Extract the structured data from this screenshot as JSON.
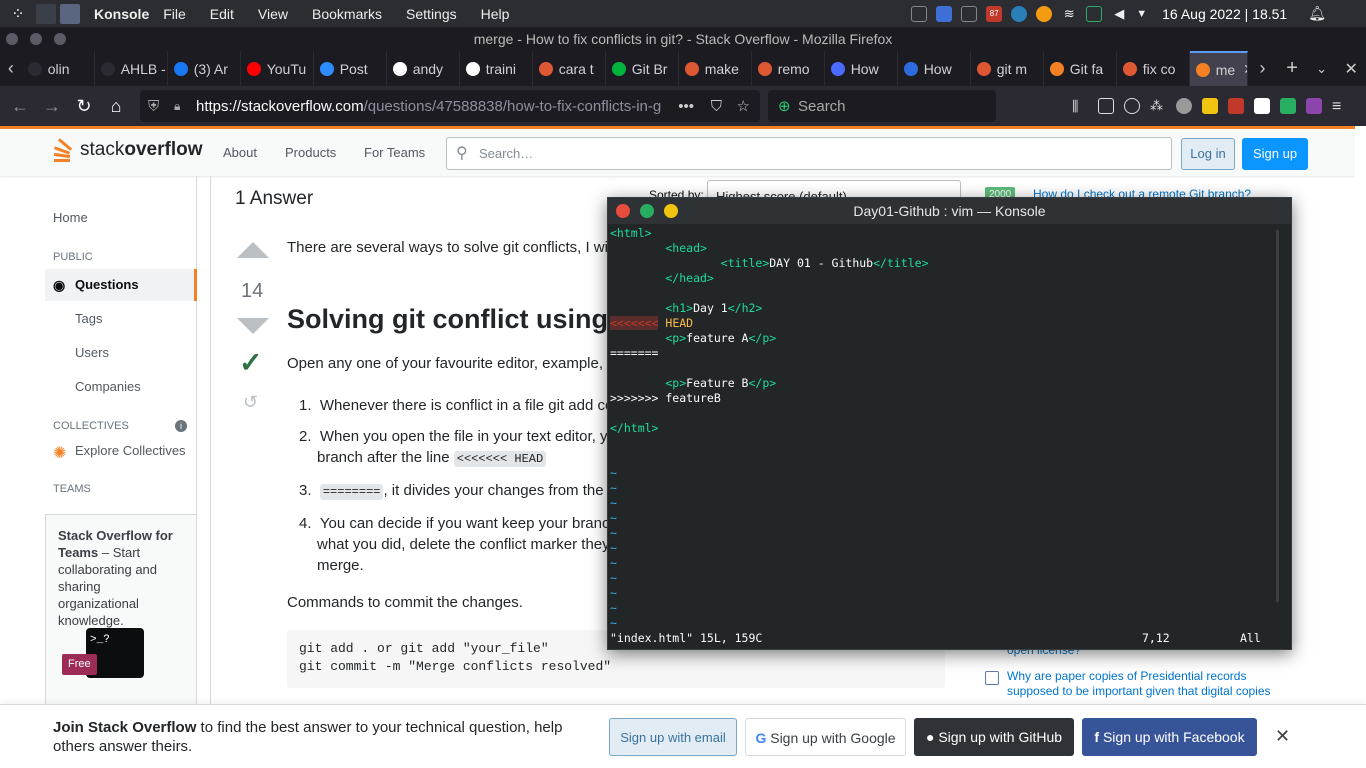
{
  "panel": {
    "app": "Konsole",
    "menu": [
      "File",
      "Edit",
      "View",
      "Bookmarks",
      "Settings",
      "Help"
    ],
    "battery": "87",
    "clock": "16 Aug 2022 | 18.51"
  },
  "firefox": {
    "title": "merge - How to fix conflicts in git? - Stack Overflow - Mozilla Firefox",
    "tabs": [
      {
        "label": "olin",
        "color": "#2b2a33"
      },
      {
        "label": "AHLB - B",
        "color": "#2b2a33"
      },
      {
        "label": "(3) Ar",
        "color": "#1877f2"
      },
      {
        "label": "YouTu",
        "color": "#ff0000"
      },
      {
        "label": "Post",
        "color": "#2d8cff"
      },
      {
        "label": "andy",
        "color": "#ffffff"
      },
      {
        "label": "traini",
        "color": "#ffffff"
      },
      {
        "label": "cara t",
        "color": "#de5833"
      },
      {
        "label": "Git Br",
        "color": "#00b33c"
      },
      {
        "label": "make",
        "color": "#de5833"
      },
      {
        "label": "remo",
        "color": "#de5833"
      },
      {
        "label": "How",
        "color": "#4b6aff"
      },
      {
        "label": "How",
        "color": "#2d6cdf"
      },
      {
        "label": "git m",
        "color": "#de5833"
      },
      {
        "label": "Git fa",
        "color": "#f48225"
      },
      {
        "label": "fix co",
        "color": "#de5833"
      },
      {
        "label": "me",
        "color": "#f48225"
      }
    ],
    "url_host": "https://stackoverflow.com",
    "url_path": "/questions/47588838/how-to-fix-conflicts-in-g",
    "search_placeholder": "Search"
  },
  "so": {
    "logo_a": "stack",
    "logo_b": "overflow",
    "nav": [
      "About",
      "Products",
      "For Teams"
    ],
    "search_placeholder": "Search…",
    "login": "Log in",
    "signup": "Sign up",
    "left": {
      "home": "Home",
      "public": "PUBLIC",
      "questions": "Questions",
      "tags": "Tags",
      "users": "Users",
      "companies": "Companies",
      "collectives": "COLLECTIVES",
      "explore": "Explore Collectives",
      "teams": "TEAMS",
      "teams_title": "Stack Overflow for Teams",
      "teams_body": " – Start collaborating and sharing organizational knowledge.",
      "free": "Free"
    },
    "answer": {
      "count": "1 Answer",
      "sorted_by": "Sorted by:",
      "sort_value": "Highest score (default)",
      "votes": "14",
      "intro": "There are several ways to solve git conflicts, I wi",
      "heading": "Solving git conflict using",
      "open": "Open any one of your favourite editor, example,",
      "steps": [
        "Whenever there is conflict in a file git add co",
        "When you open the file in your text editor, yo",
        ", it divides your changes from the",
        "You can decide if you want keep your branc"
      ],
      "step2b": "branch after the line ",
      "step2code": "<<<<<<< HEAD",
      "step3code": "========",
      "step4b": "what you did, delete the conflict marker they",
      "step4c": "merge.",
      "commands": "Commands to commit the changes.",
      "code1": "git add . or git add \"your_file\"",
      "code2": "git commit -m \"Merge conflicts resolved\""
    },
    "right": {
      "q1": "How do I check out a remote Git branch?",
      "q1score": "2000",
      "q2": "open license?",
      "q3": "Why are paper copies of Presidential records supposed to be important given that digital copies"
    },
    "banner": {
      "bold": "Join Stack Overflow",
      "rest": " to find the best answer to your technical question, help others answer theirs.",
      "email": "Sign up with email",
      "google": "Sign up with Google",
      "github": "Sign up with GitHub",
      "facebook": "Sign up with Facebook"
    }
  },
  "konsole": {
    "title": "Day01-Github : vim — Konsole",
    "lines": {
      "l1": "<html>",
      "l2": "        <head>",
      "l3a": "                <title>",
      "l3b": "DAY 01 - Github",
      "l3c": "</title>",
      "l4": "        </head>",
      "l5a": "        <h1>",
      "l5b": "Day 1",
      "l5c": "</h2>",
      "l6a": "<<<<<<<",
      "l6b": " HEAD",
      "l7a": "        <p>",
      "l7b": "feature A",
      "l7c": "</p>",
      "l8": "=======",
      "l9a": "        <p>",
      "l9b": "Feature B",
      "l9c": "</p>",
      "l10": ">>>>>>> featureB",
      "l11": "</html>"
    },
    "status_left": "\"index.html\" 15L, 159C",
    "status_pos": "7,12",
    "status_all": "All"
  }
}
